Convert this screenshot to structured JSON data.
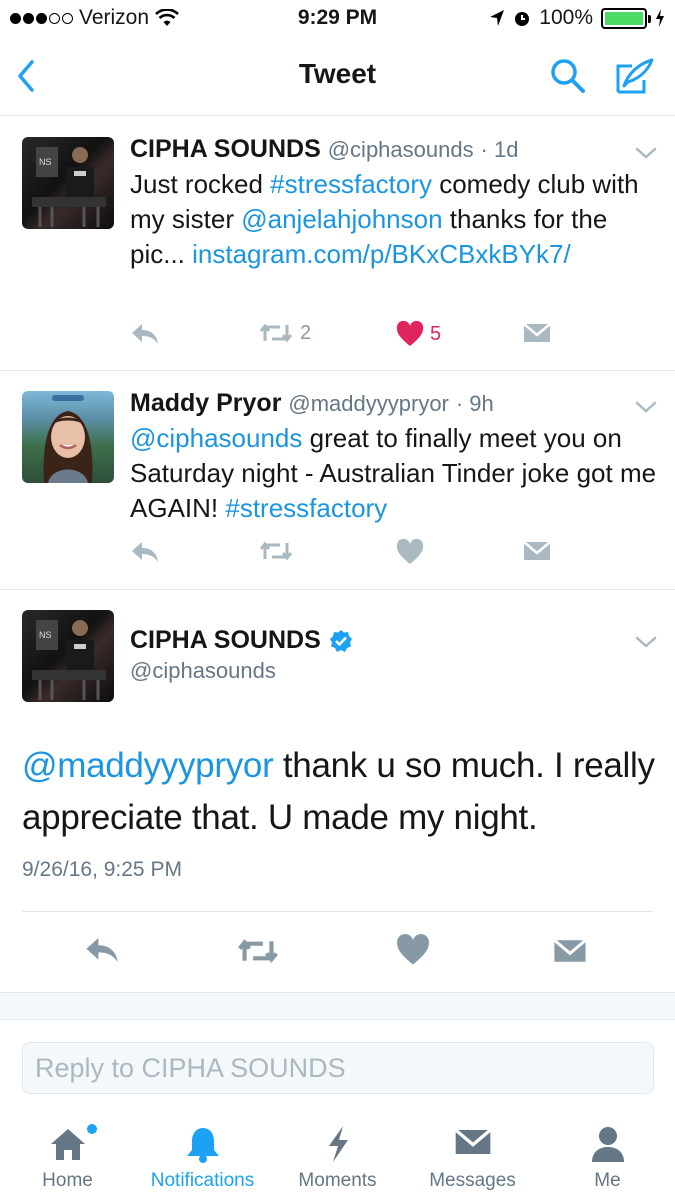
{
  "status_bar": {
    "carrier": "Verizon",
    "time": "9:29 PM",
    "battery": "100%",
    "battery_level": 1.0
  },
  "nav": {
    "title": "Tweet",
    "back_icon": "back-chevron-icon",
    "search_icon": "search-icon",
    "compose_icon": "compose-icon"
  },
  "tweets": [
    {
      "name": "CIPHA SOUNDS",
      "handle": "@ciphasounds",
      "age": "· 1d",
      "text_parts": {
        "t1": "Just rocked ",
        "hashtag": "#stressfactory",
        "t2": " comedy club with my sister ",
        "mention": "@anjelahjohnson",
        "t3": " thanks for the pic... ",
        "url": "instagram.com/p/BKxCBxkBYk7/"
      },
      "retweets": "2",
      "likes": "5"
    },
    {
      "name": "Maddy Pryor",
      "handle": "@maddyyypryor",
      "age": "· 9h",
      "text_parts": {
        "mention": "@ciphasounds",
        "t1": " great to finally meet you on Saturday night - Australian Tinder joke got me AGAIN! ",
        "hashtag": "#stressfactory"
      }
    }
  ],
  "focus_tweet": {
    "name": "CIPHA SOUNDS",
    "handle": "@ciphasounds",
    "mention": "@maddyyypryor",
    "text": " thank u so much. I really appreciate that. U made my night.",
    "timestamp": "9/26/16, 9:25 PM"
  },
  "reply": {
    "placeholder": "Reply to CIPHA SOUNDS"
  },
  "tabs": [
    {
      "label": "Home",
      "icon": "home-icon"
    },
    {
      "label": "Notifications",
      "icon": "bell-icon"
    },
    {
      "label": "Moments",
      "icon": "lightning-icon"
    },
    {
      "label": "Messages",
      "icon": "envelope-icon"
    },
    {
      "label": "Me",
      "icon": "person-icon"
    }
  ],
  "colors": {
    "accent": "#1da1f2",
    "link": "#1b95e0",
    "like": "#e0245e",
    "muted": "#657786",
    "icon_gray": "#8899a6"
  }
}
